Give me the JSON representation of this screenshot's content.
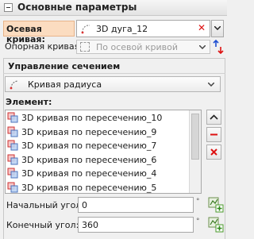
{
  "section": {
    "title": "Основные параметры"
  },
  "axis": {
    "label": "Осевая кривая:",
    "value": "3D дуга_12"
  },
  "reference": {
    "label": "Опорная кривая:",
    "placeholder": "По осевой кривой"
  },
  "section_control": {
    "title": "Управление сечением",
    "type_value": "Кривая радиуса",
    "element_label": "Элемент:",
    "elements": [
      "3D кривая по пересечению_10",
      "3D кривая по пересечению_9",
      "3D кривая по пересечению_7",
      "3D кривая по пересечению_6",
      "3D кривая по пересечению_4",
      "3D кривая по пересечению_5"
    ]
  },
  "start_angle": {
    "label": "Начальный угол:",
    "value": "0",
    "unit": "°"
  },
  "end_angle": {
    "label": "Конечный угол:",
    "value": "360",
    "unit": "°"
  }
}
